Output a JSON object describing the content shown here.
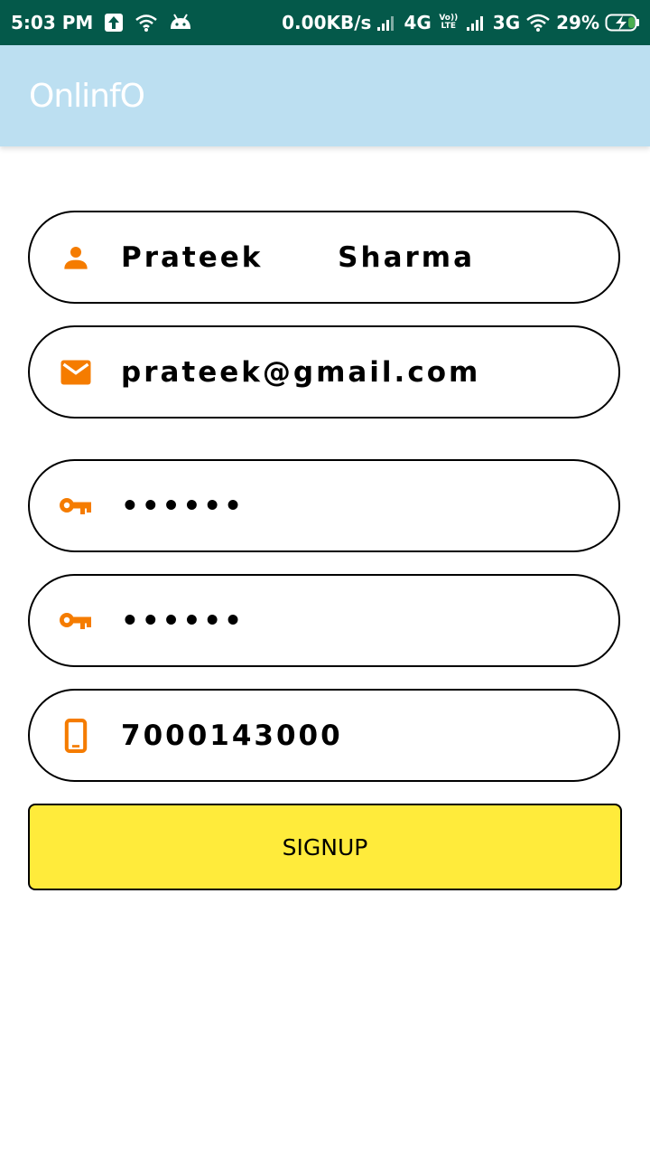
{
  "status_bar": {
    "time": "5:03 PM",
    "net_speed": "0.00KB/s",
    "network1": "4G",
    "volte": "Vo)) LTE",
    "network2": "3G",
    "battery": "29%"
  },
  "app_bar": {
    "title": "OnlinfO"
  },
  "form": {
    "name": "Prateek      Sharma",
    "email": "prateek@gmail.com",
    "password": "••••••",
    "confirm_password": "••••••",
    "phone": "7000143000"
  },
  "signup_button": {
    "label": "SIGNUP"
  },
  "colors": {
    "status_bar": "#04594a",
    "app_bar": "#bcdff1",
    "icon_accent": "#f57c00",
    "button": "#ffeb3b"
  },
  "icons": {
    "name": "person-icon",
    "email": "email-icon",
    "password": "key-icon",
    "confirm_password": "key-icon",
    "phone": "phone-icon"
  }
}
